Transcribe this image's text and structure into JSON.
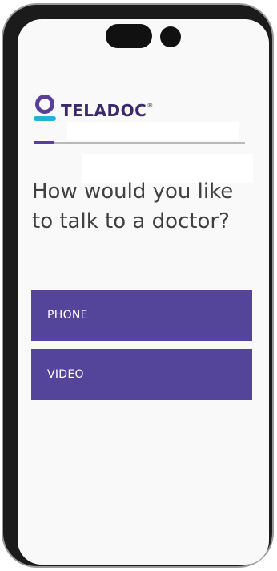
{
  "brand": {
    "name": "TELADOC",
    "mark": "®",
    "primary_color": "#5a3e99",
    "accent_color": "#21b3d6",
    "button_color": "#54459b"
  },
  "progress": {
    "fraction": 0.1
  },
  "question": {
    "text": "How would you like to talk to a doctor?"
  },
  "options": [
    {
      "label": "PHONE"
    },
    {
      "label": "VIDEO"
    }
  ]
}
